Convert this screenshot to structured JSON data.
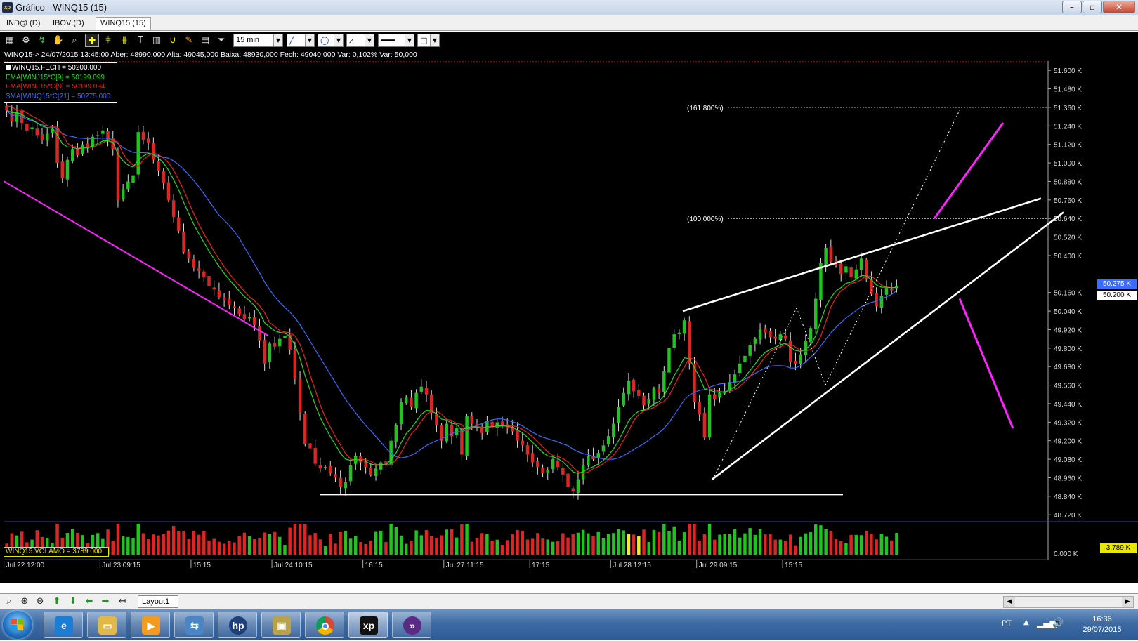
{
  "window": {
    "title": "Gráfico - WINQ15 (15)",
    "app_badge": "xp",
    "minimize": "–",
    "maximize": "▫",
    "close": "✕"
  },
  "tabs": [
    {
      "label": "IND@ (D)"
    },
    {
      "label": "IBOV (D)"
    },
    {
      "label": "WINQ15 (15)",
      "active": true
    }
  ],
  "toolbar": {
    "interval": "15 min",
    "icons": [
      "chart-type",
      "settings",
      "indicators",
      "cursor-hand",
      "zoom-chart",
      "crosshair",
      "trend-h",
      "fibonacci",
      "text",
      "horseshoe",
      "hand-draw",
      "clipboard",
      "filter"
    ]
  },
  "infobar": "WINQ15-> 24/07/2015 13:45:00 Aber: 48990,000 Alta: 49045,000 Baixa: 48930,000 Fech: 49040,000 Var: 0,102% Var: 50,000",
  "legend": [
    {
      "text": "WINQ15.FECH = 50200.000",
      "color": "#ffffff"
    },
    {
      "text": "EMA[WINJ15*C[9] = 50199.099",
      "color": "#22dd22"
    },
    {
      "text": "EMA[WINJ15*O[9] = 50199.094",
      "color": "#ee2222"
    },
    {
      "text": "SMA[WINQ15*C[21] = 50275.000",
      "color": "#3a6cff"
    }
  ],
  "volume_legend": "WINQ15.VOLAMO = 3789.000",
  "y_axis": {
    "labels": [
      "51.600 K",
      "51.480 K",
      "51.360 K",
      "51.240 K",
      "51.120 K",
      "51.000 K",
      "50.880 K",
      "50.760 K",
      "50.640 K",
      "50.520 K",
      "50.400 K",
      "50.160 K",
      "50.040 K",
      "49.920 K",
      "49.800 K",
      "49.680 K",
      "49.560 K",
      "49.440 K",
      "49.320 K",
      "49.200 K",
      "49.080 K",
      "48.960 K",
      "48.840 K",
      "48.720 K"
    ],
    "values": [
      51600,
      51480,
      51360,
      51240,
      51120,
      51000,
      50880,
      50760,
      50640,
      50520,
      50400,
      50160,
      50040,
      49920,
      49800,
      49680,
      49560,
      49440,
      49320,
      49200,
      49080,
      48960,
      48840,
      48720
    ],
    "tag_sma": "50.275 K",
    "tag_close": "50.200 K",
    "volume_tag": "3.789 K",
    "volume_cut_label": "0.000 K"
  },
  "x_axis": {
    "labels": [
      "Jul 22 12:00",
      "Jul 23 09:15",
      "15:15",
      "Jul 24 10:15",
      "16:15",
      "Jul 27 11:15",
      "17:15",
      "Jul 28 12:15",
      "Jul 29 09:15",
      "15:15"
    ]
  },
  "fib_levels": [
    {
      "label": "(161.800%)",
      "value": 51360
    },
    {
      "label": "(100.000%)",
      "value": 50640
    }
  ],
  "chart_data": {
    "type": "candlestick",
    "symbol": "WINQ15",
    "interval": "15 min",
    "ylim": [
      48680,
      51660
    ],
    "close": [
      51340,
      51270,
      51330,
      51260,
      51210,
      51230,
      51180,
      51150,
      51190,
      51220,
      51000,
      50900,
      51020,
      51090,
      51050,
      51120,
      51100,
      51170,
      51180,
      51210,
      51150,
      51090,
      50760,
      50830,
      50880,
      50920,
      51200,
      51150,
      51130,
      51020,
      50950,
      50870,
      50760,
      50650,
      50560,
      50420,
      50380,
      50320,
      50300,
      50260,
      50200,
      50180,
      50130,
      50110,
      50080,
      50060,
      50020,
      49990,
      50000,
      49950,
      49850,
      49700,
      49830,
      49810,
      49860,
      49880,
      49790,
      49600,
      49380,
      49180,
      49150,
      49050,
      49020,
      49030,
      48990,
      48960,
      48900,
      48930,
      49040,
      49100,
      49060,
      49030,
      48980,
      49020,
      49060,
      49040,
      49200,
      49300,
      49450,
      49480,
      49420,
      49510,
      49550,
      49500,
      49380,
      49300,
      49200,
      49310,
      49230,
      49280,
      49110,
      49360,
      49310,
      49280,
      49250,
      49330,
      49290,
      49320,
      49300,
      49280,
      49260,
      49200,
      49170,
      49110,
      49060,
      49030,
      48990,
      49010,
      49080,
      49030,
      48980,
      48900,
      48870,
      48950,
      49040,
      49100,
      49080,
      49120,
      49170,
      49230,
      49310,
      49420,
      49510,
      49590,
      49520,
      49490,
      49430,
      49470,
      49540,
      49510,
      49650,
      49800,
      49890,
      49900,
      49980,
      49700,
      49450,
      49370,
      49220,
      49500,
      49470,
      49510,
      49520,
      49580,
      49630,
      49700,
      49750,
      49820,
      49860,
      49920,
      49900,
      49870,
      49860,
      49890,
      49860,
      49710,
      49700,
      49760,
      49850,
      49930,
      50120,
      50350,
      50450,
      50360,
      50340,
      50280,
      50330,
      50260,
      50310,
      50380,
      50250,
      50150,
      50070,
      50140,
      50190,
      50180,
      50200
    ]
  }
}
